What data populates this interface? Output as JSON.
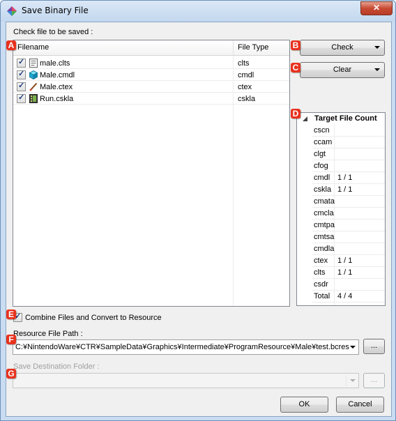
{
  "window": {
    "title": "Save Binary File",
    "close_label": "✕"
  },
  "markers": {
    "a": "A",
    "b": "B",
    "c": "C",
    "d": "D",
    "e": "E",
    "f": "F",
    "g": "G"
  },
  "check_label": "Check file to be saved :",
  "file_list": {
    "columns": [
      "Filename",
      "File Type"
    ],
    "rows": [
      {
        "name": "male.clts",
        "type": "clts",
        "checked": true,
        "icon": "clts-file-icon"
      },
      {
        "name": "Male.cmdl",
        "type": "cmdl",
        "checked": true,
        "icon": "cmdl-model-icon"
      },
      {
        "name": "Male.ctex",
        "type": "ctex",
        "checked": true,
        "icon": "ctex-texture-icon"
      },
      {
        "name": "Run.cskla",
        "type": "cskla",
        "checked": true,
        "icon": "cskla-animation-icon"
      }
    ]
  },
  "buttons": {
    "check": "Check",
    "clear": "Clear",
    "ok": "OK",
    "cancel": "Cancel",
    "browse_resource": "...",
    "browse_destination": "..."
  },
  "target_count": {
    "header": "Target File Count",
    "rows": [
      {
        "type": "cscn",
        "count": ""
      },
      {
        "type": "ccam",
        "count": ""
      },
      {
        "type": "clgt",
        "count": ""
      },
      {
        "type": "cfog",
        "count": ""
      },
      {
        "type": "cmdl",
        "count": "1 / 1"
      },
      {
        "type": "cskla",
        "count": "1 / 1"
      },
      {
        "type": "cmata",
        "count": ""
      },
      {
        "type": "cmcla",
        "count": ""
      },
      {
        "type": "cmtpa",
        "count": ""
      },
      {
        "type": "cmtsa",
        "count": ""
      },
      {
        "type": "cmdla",
        "count": ""
      },
      {
        "type": "ctex",
        "count": "1 / 1"
      },
      {
        "type": "clts",
        "count": "1 / 1"
      },
      {
        "type": "csdr",
        "count": ""
      },
      {
        "type": "Total",
        "count": "4 / 4"
      }
    ]
  },
  "combine": {
    "label": "Combine Files and Convert to Resource",
    "checked": true
  },
  "resource_path": {
    "label": "Resource File Path :",
    "value": "C:¥NintendoWare¥CTR¥SampleData¥Graphics¥Intermediate¥ProgramResource¥Male¥test.bcres"
  },
  "destination": {
    "label": "Save Destination Folder :",
    "value": ""
  },
  "colors": {
    "marker_red": "#e8321e",
    "window_frame": "#c9dcf1",
    "dialog_bg": "#f0f0f0"
  }
}
